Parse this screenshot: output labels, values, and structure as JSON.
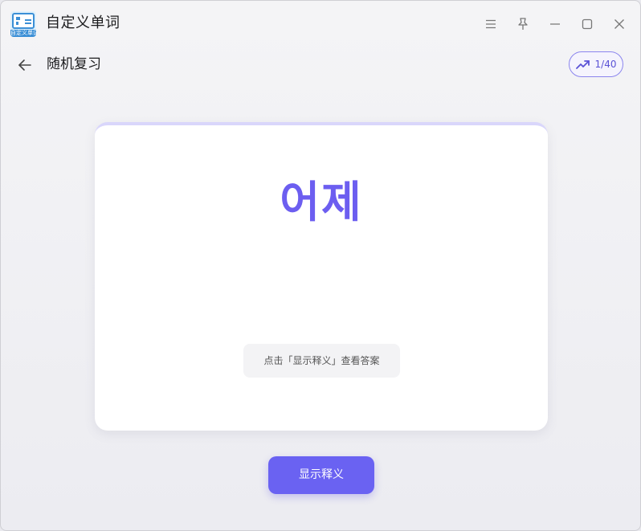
{
  "app": {
    "title": "自定义单词",
    "icon_label": "自定义单词",
    "icon_name": "vocabulary-book-icon"
  },
  "window_controls": {
    "menu_icon": "hamburger-menu-icon",
    "pin_icon": "pin-icon",
    "minimize_icon": "minimize-icon",
    "maximize_icon": "maximize-icon",
    "close_icon": "close-icon"
  },
  "header": {
    "back_icon": "arrow-left-icon",
    "page_title": "随机复习",
    "progress": {
      "icon": "trending-up-icon",
      "label": "1/40",
      "current": 1,
      "total": 40
    }
  },
  "card": {
    "word": "어제",
    "hint": "点击「显示释义」查看答案"
  },
  "actions": {
    "reveal_label": "显示释义"
  },
  "colors": {
    "accent": "#6a62f2",
    "word_color": "#6c5ef0",
    "background": "#f1f1f4",
    "card": "#ffffff"
  }
}
